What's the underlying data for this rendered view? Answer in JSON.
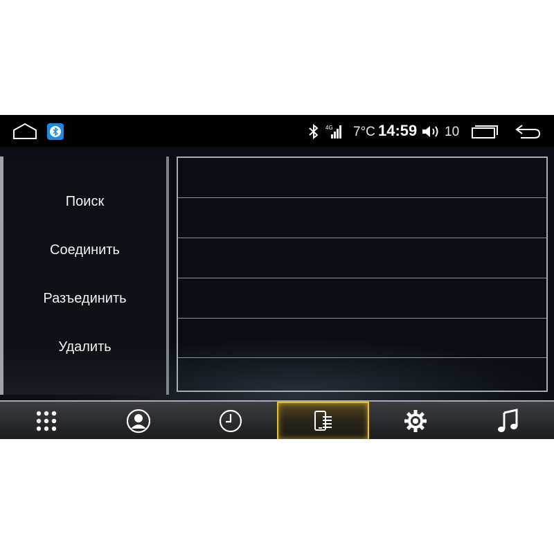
{
  "status_bar": {
    "temperature": "7°C",
    "time": "14:59",
    "volume": "10",
    "icons": [
      "home-icon",
      "bluetooth-app-icon",
      "bluetooth-icon",
      "signal-4g-icon",
      "volume-icon",
      "recent-apps-icon",
      "back-icon"
    ]
  },
  "menu": {
    "items": [
      {
        "label": "Поиск"
      },
      {
        "label": "Соединить"
      },
      {
        "label": "Разъединить"
      },
      {
        "label": "Удалить"
      }
    ]
  },
  "device_list": {
    "rows": [
      "",
      "",
      "",
      "",
      "",
      ""
    ]
  },
  "nav": {
    "items": [
      {
        "icon": "keypad-icon",
        "active": false
      },
      {
        "icon": "contacts-icon",
        "active": false
      },
      {
        "icon": "call-log-icon",
        "active": false
      },
      {
        "icon": "paired-devices-icon",
        "active": true
      },
      {
        "icon": "settings-icon",
        "active": false
      },
      {
        "icon": "music-icon",
        "active": false
      }
    ]
  },
  "colors": {
    "accent": "#e8c02a",
    "bluetooth_app": "#1e88e5",
    "background": "#0a0e14"
  }
}
